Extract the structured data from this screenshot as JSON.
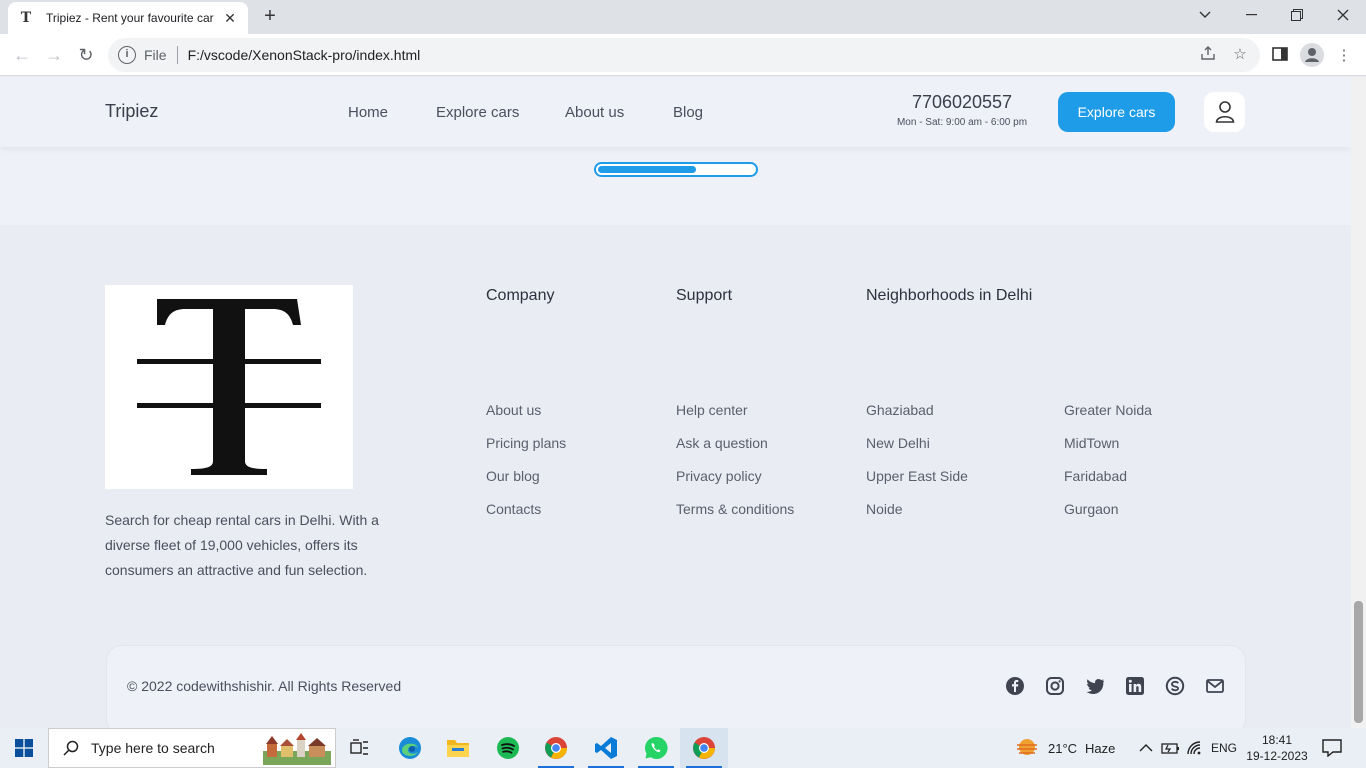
{
  "browser": {
    "tab_title": "Tripiez - Rent your favourite car",
    "tab_favicon": "T",
    "url_scheme": "File",
    "url": "F:/vscode/XenonStack-pro/index.html"
  },
  "header": {
    "brand": "Tripiez",
    "nav": [
      "Home",
      "Explore cars",
      "About us",
      "Blog"
    ],
    "phone": "7706020557",
    "hours": "Mon - Sat: 9:00 am - 6:00 pm",
    "cta": "Explore cars",
    "accent": "#1e9ce8"
  },
  "slider": {
    "progress": 0.63
  },
  "footer": {
    "about": "Search for cheap rental cars in Delhi. With a diverse fleet of 19,000 vehicles, offers its consumers an attractive and fun selection.",
    "company": {
      "title": "Company",
      "links": [
        "About us",
        "Pricing plans",
        "Our blog",
        "Contacts"
      ]
    },
    "support": {
      "title": "Support",
      "links": [
        "Help center",
        "Ask a question",
        "Privacy policy",
        "Terms & conditions"
      ]
    },
    "neighborhoods": {
      "title": "Neighborhoods in Delhi",
      "col1": [
        "Ghaziabad",
        "New Delhi",
        "Upper East Side",
        "Noide"
      ],
      "col2": [
        "Greater Noida",
        "MidTown",
        "Faridabad",
        "Gurgaon"
      ]
    },
    "copyright": "© 2022 codewithshishir. All Rights Reserved",
    "social": [
      "facebook-icon",
      "instagram-icon",
      "twitter-icon",
      "linkedin-icon",
      "skype-icon",
      "mail-icon"
    ]
  },
  "taskbar": {
    "search_placeholder": "Type here to search",
    "weather_temp": "21°C",
    "weather_text": "Haze",
    "lang": "ENG",
    "time": "18:41",
    "date": "19-12-2023"
  }
}
